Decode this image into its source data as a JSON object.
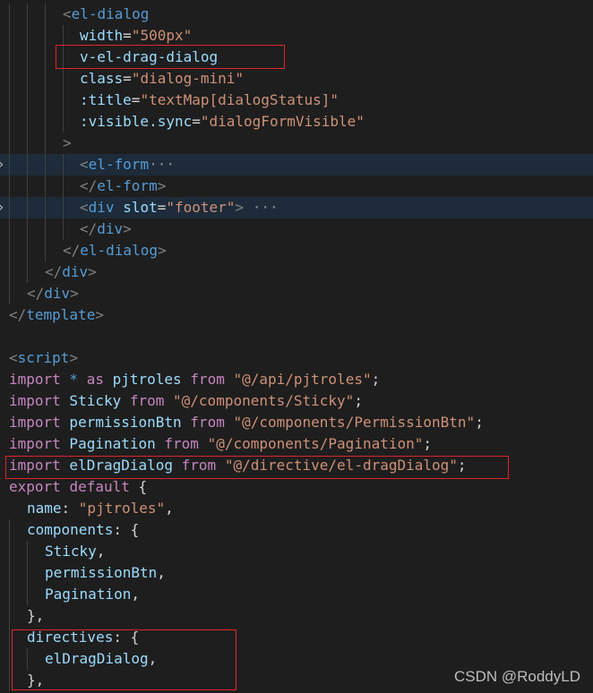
{
  "colors": {
    "background": "#1e1e1e",
    "highlight_row": "#1d2b3a",
    "tag": "#569cd6",
    "attribute": "#9cdcfe",
    "string": "#ce9178",
    "keyword": "#c586c0",
    "punctuation": "#808080",
    "annotation_box": "#e0242b"
  },
  "lines": [
    [
      {
        "t": "<",
        "c": "c-punc"
      },
      {
        "t": "el-dialog",
        "c": "c-tag"
      }
    ],
    [
      {
        "t": "width",
        "c": "c-attr"
      },
      {
        "t": "=",
        "c": "c-plain"
      },
      {
        "t": "\"500px\"",
        "c": "c-str"
      }
    ],
    [
      {
        "t": "v-el-drag-dialog",
        "c": "c-attr"
      }
    ],
    [
      {
        "t": "class",
        "c": "c-attr"
      },
      {
        "t": "=",
        "c": "c-plain"
      },
      {
        "t": "\"dialog-mini\"",
        "c": "c-str"
      }
    ],
    [
      {
        "t": ":title",
        "c": "c-attr"
      },
      {
        "t": "=",
        "c": "c-plain"
      },
      {
        "t": "\"textMap[dialogStatus]\"",
        "c": "c-str"
      }
    ],
    [
      {
        "t": ":visible.sync",
        "c": "c-attr"
      },
      {
        "t": "=",
        "c": "c-plain"
      },
      {
        "t": "\"dialogFormVisible\"",
        "c": "c-str"
      }
    ],
    [
      {
        "t": ">",
        "c": "c-punc"
      }
    ],
    [
      {
        "t": "<",
        "c": "c-punc"
      },
      {
        "t": "el-form",
        "c": "c-tag"
      },
      {
        "t": "···",
        "c": "ellipsis"
      }
    ],
    [
      {
        "t": "</",
        "c": "c-punc"
      },
      {
        "t": "el-form",
        "c": "c-tag"
      },
      {
        "t": ">",
        "c": "c-punc"
      }
    ],
    [
      {
        "t": "<",
        "c": "c-punc"
      },
      {
        "t": "div",
        "c": "c-tag"
      },
      {
        "t": " ",
        "c": "c-plain"
      },
      {
        "t": "slot",
        "c": "c-attr"
      },
      {
        "t": "=",
        "c": "c-plain"
      },
      {
        "t": "\"footer\"",
        "c": "c-str"
      },
      {
        "t": ">",
        "c": "c-punc"
      },
      {
        "t": " ···",
        "c": "ellipsis"
      }
    ],
    [
      {
        "t": "</",
        "c": "c-punc"
      },
      {
        "t": "div",
        "c": "c-tag"
      },
      {
        "t": ">",
        "c": "c-punc"
      }
    ],
    [
      {
        "t": "</",
        "c": "c-punc"
      },
      {
        "t": "el-dialog",
        "c": "c-tag"
      },
      {
        "t": ">",
        "c": "c-punc"
      }
    ],
    [
      {
        "t": "</",
        "c": "c-punc"
      },
      {
        "t": "div",
        "c": "c-tag"
      },
      {
        "t": ">",
        "c": "c-punc"
      }
    ],
    [
      {
        "t": "</",
        "c": "c-punc"
      },
      {
        "t": "div",
        "c": "c-tag"
      },
      {
        "t": ">",
        "c": "c-punc"
      }
    ],
    [
      {
        "t": "</",
        "c": "c-punc"
      },
      {
        "t": "template",
        "c": "c-tag"
      },
      {
        "t": ">",
        "c": "c-punc"
      }
    ],
    [],
    [
      {
        "t": "<",
        "c": "c-punc"
      },
      {
        "t": "script",
        "c": "c-tag"
      },
      {
        "t": ">",
        "c": "c-punc"
      }
    ],
    [
      {
        "t": "import",
        "c": "c-kw"
      },
      {
        "t": " * ",
        "c": "c-kw2"
      },
      {
        "t": "as",
        "c": "c-kw"
      },
      {
        "t": " pjtroles ",
        "c": "c-id"
      },
      {
        "t": "from",
        "c": "c-kw"
      },
      {
        "t": " \"@/api/pjtroles\"",
        "c": "c-str"
      },
      {
        "t": ";",
        "c": "c-plain"
      }
    ],
    [
      {
        "t": "import",
        "c": "c-kw"
      },
      {
        "t": " Sticky ",
        "c": "c-id"
      },
      {
        "t": "from",
        "c": "c-kw"
      },
      {
        "t": " \"@/components/Sticky\"",
        "c": "c-str"
      },
      {
        "t": ";",
        "c": "c-plain"
      }
    ],
    [
      {
        "t": "import",
        "c": "c-kw"
      },
      {
        "t": " permissionBtn ",
        "c": "c-id"
      },
      {
        "t": "from",
        "c": "c-kw"
      },
      {
        "t": " \"@/components/PermissionBtn\"",
        "c": "c-str"
      },
      {
        "t": ";",
        "c": "c-plain"
      }
    ],
    [
      {
        "t": "import",
        "c": "c-kw"
      },
      {
        "t": " Pagination ",
        "c": "c-id"
      },
      {
        "t": "from",
        "c": "c-kw"
      },
      {
        "t": " \"@/components/Pagination\"",
        "c": "c-str"
      },
      {
        "t": ";",
        "c": "c-plain"
      }
    ],
    [
      {
        "t": "import",
        "c": "c-kw"
      },
      {
        "t": " elDragDialog ",
        "c": "c-id"
      },
      {
        "t": "from",
        "c": "c-kw"
      },
      {
        "t": " \"@/directive/el-dragDialog\"",
        "c": "c-str"
      },
      {
        "t": ";",
        "c": "c-plain"
      }
    ],
    [
      {
        "t": "export",
        "c": "c-kw"
      },
      {
        "t": " ",
        "c": "c-plain"
      },
      {
        "t": "default",
        "c": "c-kw"
      },
      {
        "t": " {",
        "c": "c-plain"
      }
    ],
    [
      {
        "t": "name",
        "c": "c-attr"
      },
      {
        "t": ": ",
        "c": "c-plain"
      },
      {
        "t": "\"pjtroles\"",
        "c": "c-str"
      },
      {
        "t": ",",
        "c": "c-plain"
      }
    ],
    [
      {
        "t": "components",
        "c": "c-attr"
      },
      {
        "t": ": {",
        "c": "c-plain"
      }
    ],
    [
      {
        "t": "Sticky",
        "c": "c-id"
      },
      {
        "t": ",",
        "c": "c-plain"
      }
    ],
    [
      {
        "t": "permissionBtn",
        "c": "c-id"
      },
      {
        "t": ",",
        "c": "c-plain"
      }
    ],
    [
      {
        "t": "Pagination",
        "c": "c-id"
      },
      {
        "t": ",",
        "c": "c-plain"
      }
    ],
    [
      {
        "t": "},",
        "c": "c-plain"
      }
    ],
    [
      {
        "t": "directives",
        "c": "c-attr"
      },
      {
        "t": ": {",
        "c": "c-plain"
      }
    ],
    [
      {
        "t": "elDragDialog",
        "c": "c-id"
      },
      {
        "t": ",",
        "c": "c-plain"
      }
    ],
    [
      {
        "t": "},",
        "c": "c-plain"
      }
    ]
  ],
  "watermark": "CSDN @RoddyLD"
}
